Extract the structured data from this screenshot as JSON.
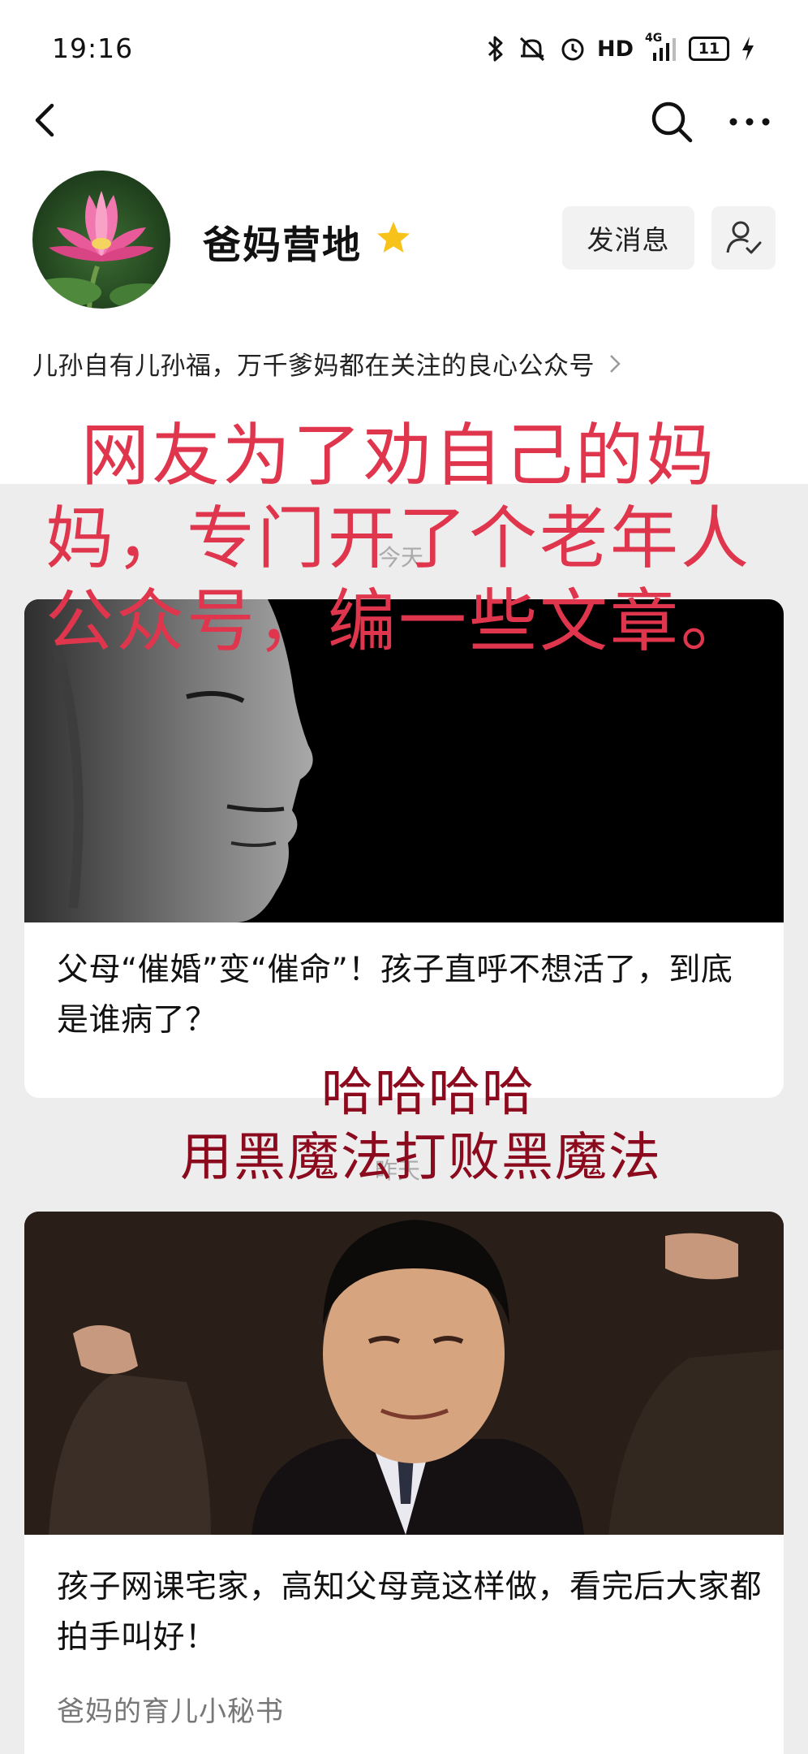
{
  "status_bar": {
    "time": "19:16",
    "icons": [
      "bluetooth-icon",
      "mute-icon",
      "alarm-icon",
      "hd-icon",
      "signal-icon",
      "battery-icon",
      "charging-icon"
    ],
    "hd_label": "HD",
    "network_label": "4G",
    "battery_level": "11"
  },
  "nav": {
    "icons": [
      "back-arrow-icon",
      "search-icon",
      "more-icon"
    ]
  },
  "profile": {
    "name": "爸妈营地",
    "message_button": "发消息",
    "description": "儿孙自有儿孙福，万千爹妈都在关注的良心公众号"
  },
  "feed": {
    "date_today": "今天",
    "date_yesterday": "昨天",
    "articles": [
      {
        "title": "父母“催婚”变“催命”！孩子直呼不想活了，到底是谁病了？"
      },
      {
        "title": "孩子网课宅家，高知父母竟这样做，看完后大家都拍手叫好！",
        "source": "爸妈的育儿小秘书"
      }
    ]
  },
  "captions": {
    "red": [
      "网友为了劝自己的妈",
      "妈，专门开了个老年人",
      "公众号，编一些文章。"
    ],
    "dark": [
      "哈哈哈哈",
      "用黑魔法打败黑魔法"
    ]
  },
  "colors": {
    "caption_red": "#e0364d",
    "caption_dark": "#8b0a1d",
    "verified_star": "#f7c21a",
    "page_bg": "#ededed"
  }
}
